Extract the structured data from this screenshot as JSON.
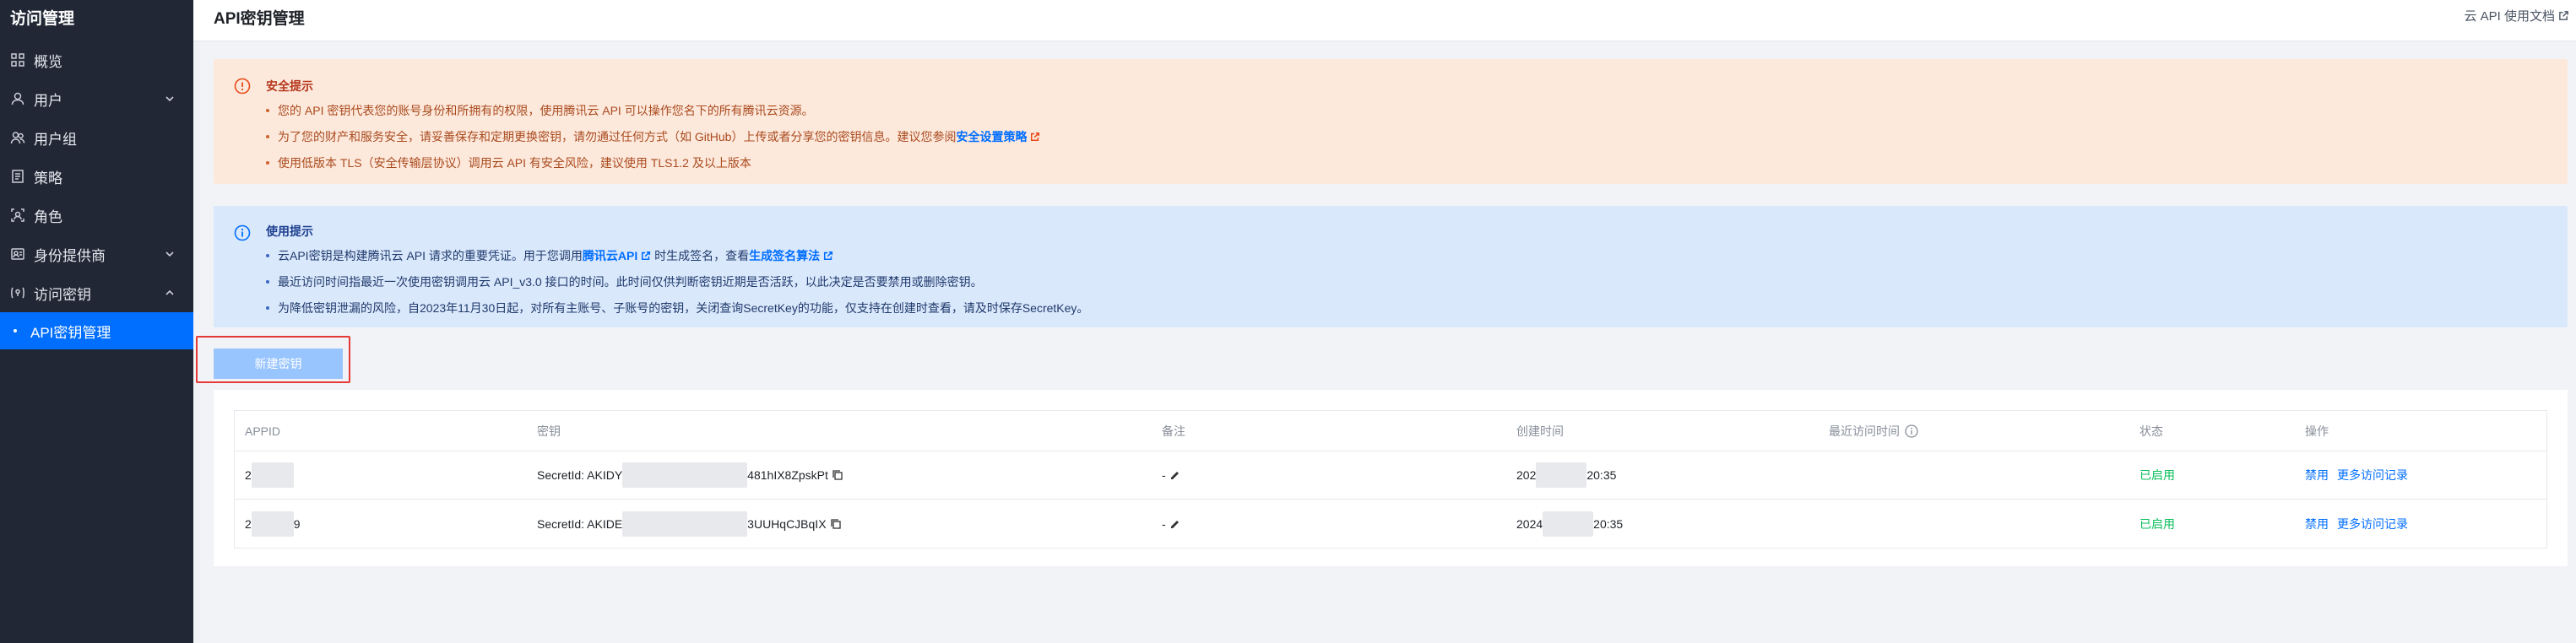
{
  "sidebar": {
    "title": "访问管理",
    "items": [
      {
        "label": "概览",
        "icon": "overview-icon",
        "chevron": ""
      },
      {
        "label": "用户",
        "icon": "user-icon",
        "chevron": "down"
      },
      {
        "label": "用户组",
        "icon": "user-group-icon",
        "chevron": ""
      },
      {
        "label": "策略",
        "icon": "policy-icon",
        "chevron": ""
      },
      {
        "label": "角色",
        "icon": "role-icon",
        "chevron": ""
      },
      {
        "label": "身份提供商",
        "icon": "identity-provider-icon",
        "chevron": "down"
      },
      {
        "label": "访问密钥",
        "icon": "access-key-icon",
        "chevron": "up"
      },
      {
        "label": "API密钥管理",
        "icon": "",
        "chevron": "",
        "active": true
      }
    ]
  },
  "header": {
    "title": "API密钥管理",
    "doc_link": "云 API 使用文档"
  },
  "security_alert": {
    "title": "安全提示",
    "items": [
      "您的 API 密钥代表您的账号身份和所拥有的权限，使用腾讯云 API 可以操作您名下的所有腾讯云资源。",
      "为了您的财产和服务安全，请妥善保存和定期更换密钥，请勿通过任何方式（如 GitHub）上传或者分享您的密钥信息。建议您参阅",
      "使用低版本 TLS（安全传输层协议）调用云 API 有安全风险，建议使用 TLS1.2 及以上版本"
    ],
    "link": "安全设置策略"
  },
  "usage_alert": {
    "title": "使用提示",
    "item1_prefix": "云API密钥是构建腾讯云 API 请求的重要凭证。用于您调用",
    "item1_link1": "腾讯云API",
    "item1_middle": "时生成签名，查看",
    "item1_link2": "生成签名算法",
    "item2": "最近访问时间指最近一次使用密钥调用云 API_v3.0 接口的时间。此时间仅供判断密钥近期是否活跃，以此决定是否要禁用或删除密钥。",
    "item3": "为降低密钥泄漏的风险，自2023年11月30日起，对所有主账号、子账号的密钥，关闭查询SecretKey的功能，仅支持在创建时查看，请及时保存SecretKey。"
  },
  "new_key_button": "新建密钥",
  "table": {
    "headers": [
      "APPID",
      "密钥",
      "备注",
      "创建时间",
      "最近访问时间",
      "状态",
      "操作"
    ],
    "rows": [
      {
        "appid_prefix": "2",
        "appid_suffix": "",
        "secret_prefix": "SecretId: AKIDY",
        "secret_suffix": "481hIX8ZpskPt",
        "remark": "-",
        "created_prefix": "202",
        "created_suffix": "20:35",
        "last_access": "",
        "status": "已启用",
        "op1": "禁用",
        "op2": "更多访问记录"
      },
      {
        "appid_prefix": "2",
        "appid_suffix": "9",
        "secret_prefix": "SecretId: AKIDE",
        "secret_suffix": "3UUHqCJBqIX",
        "remark": "-",
        "created_prefix": "2024",
        "created_suffix": "20:35",
        "last_access": "",
        "status": "已启用",
        "op1": "禁用",
        "op2": "更多访问记录"
      }
    ]
  },
  "colors": {
    "sidebar_bg": "#212735",
    "active_bg": "#006eff",
    "warn_bg": "#fde9dc",
    "info_bg": "#dae8fc",
    "status_green": "#0abf5b",
    "highlight_red": "#e53935"
  }
}
